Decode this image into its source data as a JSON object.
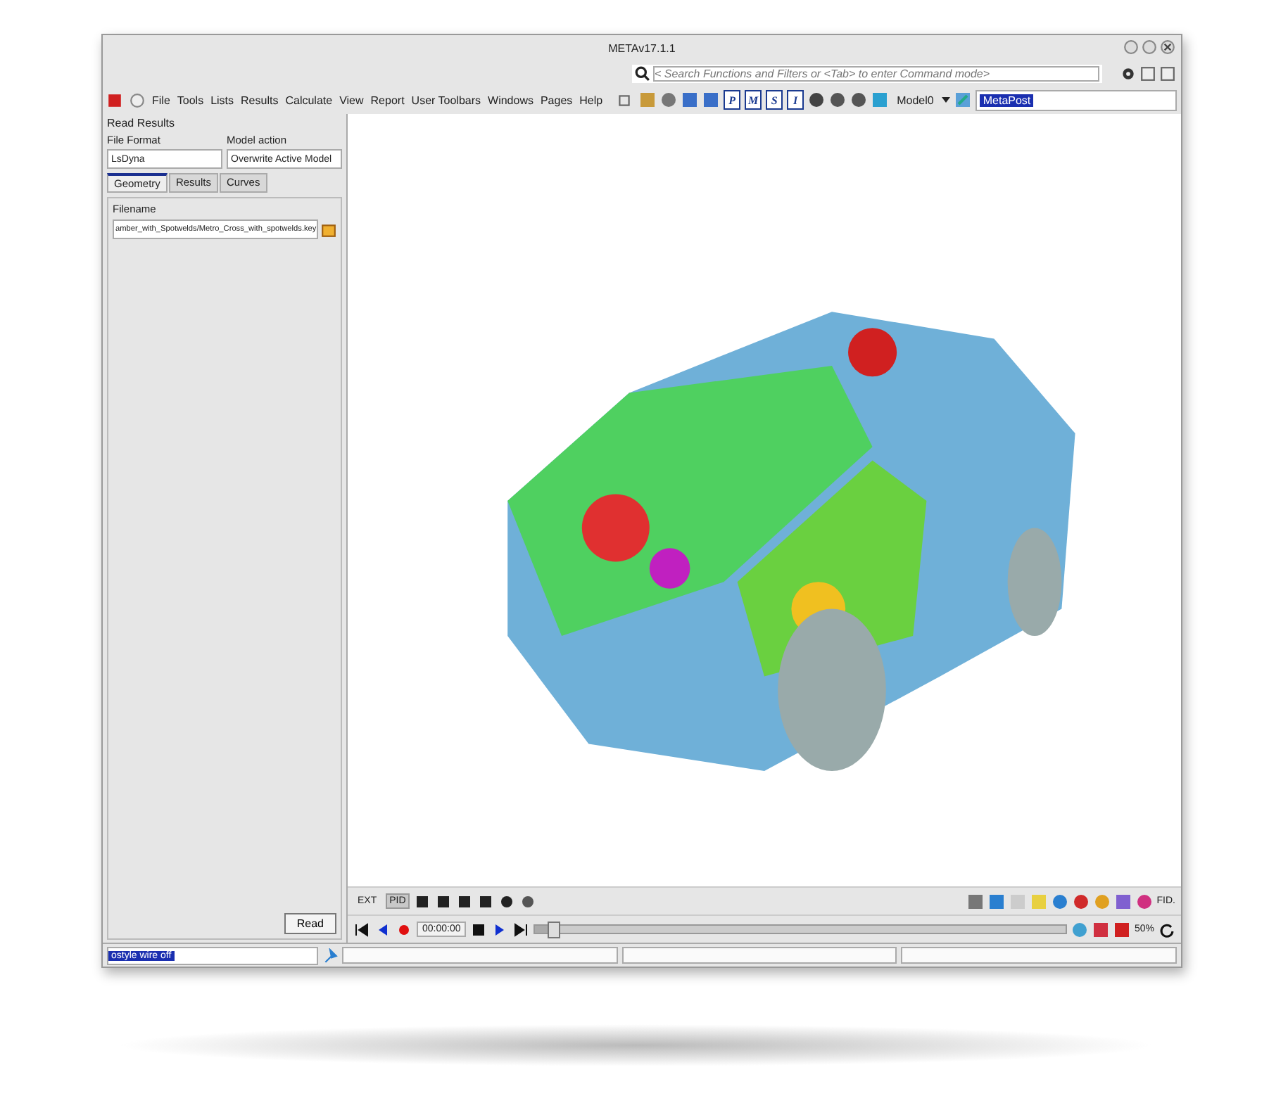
{
  "window": {
    "title": "METAv17.1.1"
  },
  "search": {
    "placeholder": "< Search Functions and Filters or <Tab> to enter Command mode>"
  },
  "menu": [
    "File",
    "Tools",
    "Lists",
    "Results",
    "Calculate",
    "View",
    "Report",
    "User Toolbars",
    "Windows",
    "Pages",
    "Help"
  ],
  "model_selector": {
    "value": "Model0"
  },
  "session_field": {
    "value": "MetaPost"
  },
  "panel": {
    "title": "Read Results",
    "file_format": {
      "label": "File Format",
      "value": "LsDyna"
    },
    "model_action": {
      "label": "Model action",
      "value": "Overwrite Active Model"
    },
    "tabs": [
      {
        "label": "Geometry",
        "selected": true
      },
      {
        "label": "Results",
        "selected": false
      },
      {
        "label": "Curves",
        "selected": false
      }
    ],
    "filename": {
      "label": "Filename",
      "value": "amber_with_Spotwelds/Metro_Cross_with_spotwelds.key"
    },
    "read_button": "Read"
  },
  "toolbar": {
    "letter_buttons": [
      "P",
      "M",
      "S",
      "I"
    ]
  },
  "bottom_toolbar": {
    "buttons": [
      {
        "label": "EXT",
        "pressed": false
      },
      {
        "label": "PID",
        "pressed": true
      }
    ],
    "time": "00:00:00",
    "fringe_label": "FID.",
    "percent": "50%"
  },
  "animation": {
    "level": 0.03
  },
  "command_field": {
    "value": "ostyle wire off"
  }
}
